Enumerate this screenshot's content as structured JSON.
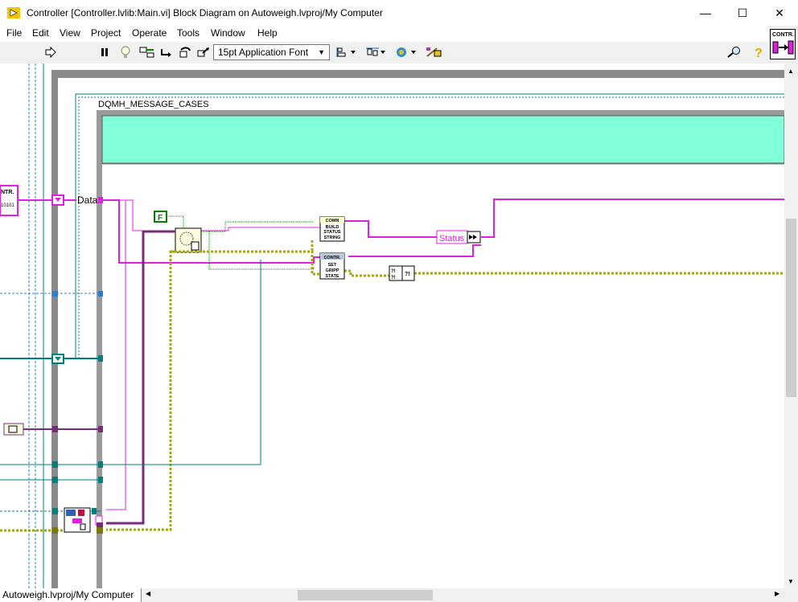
{
  "window": {
    "title": "Controller [Controller.lvlib:Main.vi] Block Diagram on Autoweigh.lvproj/My Computer",
    "minimize_glyph": "—",
    "maximize_glyph": "☐",
    "close_glyph": "✕"
  },
  "menu": {
    "items": [
      "File",
      "Edit",
      "View",
      "Project",
      "Operate",
      "Tools",
      "Window",
      "Help"
    ]
  },
  "toolbar": {
    "font_selector": "15pt Application Font",
    "vi_icon_label": "CONTR."
  },
  "diagram": {
    "case_structure_label": "DQMH_MESSAGE_CASES",
    "data_label": "Data",
    "boolean_constant": "F",
    "status_indicator": "Status",
    "subvi_build_status": [
      "COMN",
      "BUILD",
      "STATUS",
      "STRING"
    ],
    "subvi_set_gripp": [
      "CONTR.",
      "SET",
      "GRIPP",
      "STATE"
    ],
    "left_node_label": "NTR.",
    "left_node_bits": "10101"
  },
  "statusbar": {
    "text": "Autoweigh.lvproj/My Computer"
  },
  "colors": {
    "pink_wire": "#e020e0",
    "yellow_wire": "#c8c800",
    "teal_wire": "#007f7f",
    "blue_wire": "#2060c0",
    "purple_wire": "#7a2a7a",
    "case_header": "#80ffd8"
  }
}
